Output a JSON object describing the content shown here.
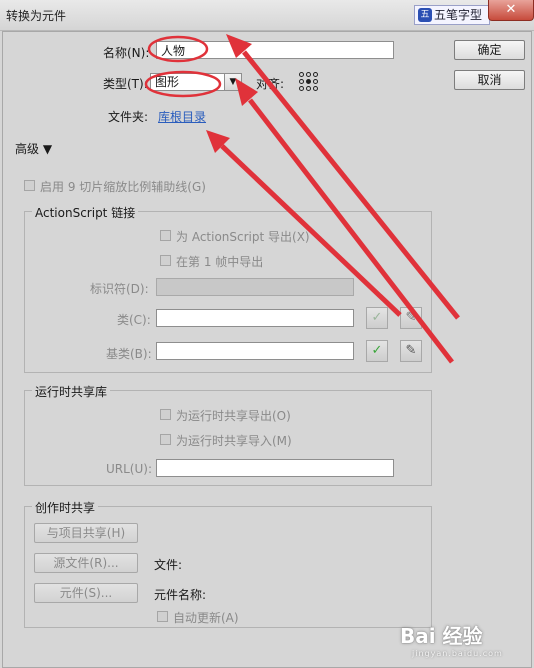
{
  "window": {
    "title": "转换为元件",
    "close_glyph": "✕"
  },
  "ime": {
    "logo": "五",
    "label": "五笔字型"
  },
  "form": {
    "name_label": "名称(N):",
    "name_value": "人物",
    "type_label": "类型(T):",
    "type_value": "图形",
    "registration_label": "对齐:",
    "folder_label": "文件夹:",
    "folder_link": "库根目录"
  },
  "buttons": {
    "ok": "确定",
    "cancel": "取消"
  },
  "advanced": {
    "label": "高级 ▼"
  },
  "nine_slice": {
    "label": "启用 9 切片缩放比例辅助线(G)"
  },
  "actionscript": {
    "title": "ActionScript 链接",
    "export_label": "为 ActionScript 导出(X)",
    "frame1_label": "在第 1 帧中导出",
    "identifier_label": "标识符(D):",
    "class_label": "类(C):",
    "base_class_label": "基类(B):"
  },
  "runtime": {
    "title": "运行时共享库",
    "export_label": "为运行时共享导出(O)",
    "import_label": "为运行时共享导入(M)",
    "url_label": "URL(U):"
  },
  "authortime": {
    "title": "创作时共享",
    "share_button": "与项目共享(H)",
    "source_button": "源文件(R)...",
    "file_label": "文件:",
    "symbol_button": "元件(S)...",
    "symbol_name_label": "元件名称:",
    "auto_update_label": "自动更新(A)"
  },
  "icons": {
    "check": "✓",
    "pencil": "✎"
  },
  "watermark": {
    "text": "Bai 经验",
    "sub": "jingyan.baidu.com"
  },
  "colors": {
    "annotation": "#e0323a",
    "link": "#2a5dbd"
  }
}
